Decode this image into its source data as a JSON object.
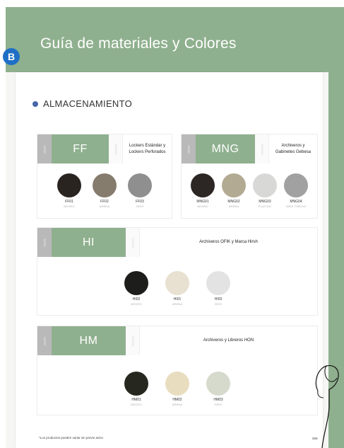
{
  "header": {
    "title": "Guía de materiales y Colores",
    "badge": "B"
  },
  "section": {
    "title": "ALMACENAMIENTO"
  },
  "cards": [
    {
      "tag": "SERIE",
      "code": "FF",
      "mini": "SERIES",
      "description": "Lockers Estándar y Lockers Perforados",
      "swatches": [
        {
          "code": "FF01",
          "name": "NEGRO",
          "color": "#2a2421"
        },
        {
          "code": "FF02",
          "name": "ARENA",
          "color": "#857c6e"
        },
        {
          "code": "FF03",
          "name": "GRIS",
          "color": "#8f8f8f"
        }
      ]
    },
    {
      "tag": "SERIE",
      "code": "MNG",
      "mini": "SERIES",
      "description": "Archiveros y Gabinetes Gebesa",
      "swatches": [
        {
          "code": "MNG01",
          "name": "NEGRO",
          "color": "#2c2724"
        },
        {
          "code": "MNG02",
          "name": "ARENA",
          "color": "#b3aa93"
        },
        {
          "code": "MNG03",
          "name": "PLATINO",
          "color": "#d8d8d6"
        },
        {
          "code": "MNG04",
          "name": "GRIS TIÑOSO",
          "color": "#a1a1a1"
        }
      ]
    },
    {
      "tag": "SERIE",
      "code": "HI",
      "mini": "SERIES",
      "description": "Archiveros OFIK y Marca Hirsh",
      "swatches": [
        {
          "code": "HI02",
          "name": "NEGRO",
          "color": "#1d1d1b"
        },
        {
          "code": "HI01",
          "name": "ARENA",
          "color": "#e8e1d1"
        },
        {
          "code": "HI03",
          "name": "GRIS",
          "color": "#e3e3e3"
        }
      ]
    },
    {
      "tag": "SERIE",
      "code": "HM",
      "mini": "SERIES",
      "description": "Archiveros y Libreros HON",
      "swatches": [
        {
          "code": "HM01",
          "name": "NEGRO",
          "color": "#26271f"
        },
        {
          "code": "HM02",
          "name": "ARENA",
          "color": "#e9ddc0"
        },
        {
          "code": "HM03",
          "name": "GRIS",
          "color": "#d6dacd"
        }
      ]
    }
  ],
  "footer": {
    "note": "*Los productos pueden variar sin previo aviso",
    "page": "069"
  },
  "colors": {
    "accent_green": "#8fb08e",
    "badge_blue": "#1f6fc5",
    "dot_blue": "#4766a8"
  }
}
